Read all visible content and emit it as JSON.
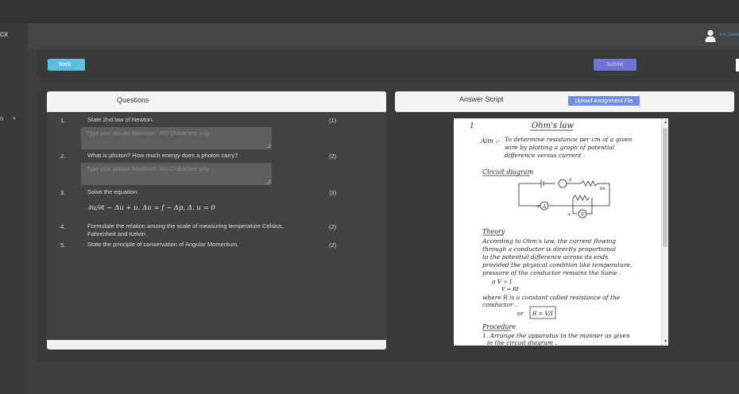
{
  "app": {
    "brand_fragment": "cx",
    "sidebar_fragment": "n",
    "user_name": "Eric Danielsen"
  },
  "toolbar": {
    "back_label": "Back",
    "submit_label": "Submit"
  },
  "questions_panel": {
    "title": "Questions",
    "answer_placeholder": "Type your answer Maximum  300 Characters only",
    "items": [
      {
        "num": "1.",
        "text": "State 2nd law of Newton.",
        "marks": "(1)"
      },
      {
        "num": "2.",
        "text": "What is photon? How much energy does a photon carry?",
        "marks": "(2)"
      },
      {
        "num": "3.",
        "text": "Solve the equation:",
        "marks": "(3)"
      },
      {
        "num": "4.",
        "text": "Formulate the relation among the scale of measuring temperature Celsius, Fahrenheit and Kelvin.",
        "marks": "(2)"
      },
      {
        "num": "5.",
        "text": "State the principle of conservation of Angular Momentum.",
        "marks": "(2)"
      }
    ],
    "equation": "∂u/∂t − Δu + u. Δu = f − Δp, Δ. u = 0"
  },
  "answer_panel": {
    "title": "Answer Script",
    "upload_label": "Upload Assignment File",
    "script": {
      "page_num": "1",
      "heading": "Ohm's law",
      "aim_label": "Aim :-",
      "aim_lines": [
        "To  determine resistance per cm of a given",
        "wire  by  plotting  a  graph of potential",
        "difference  versus current ."
      ],
      "circuit_label": "Circuit diagram",
      "theory_label": "Theory",
      "theory_lines": [
        "According  to  Ohm's law,  the  current flowing",
        "through  a  conductor  is  directly  proportional",
        "to  the  potential  difference  across  its  ends",
        "provided  the  physical  condition  like  temperature,",
        "pressure  of  the  conductor  remains  the  Same ."
      ],
      "prop_line": "a    V ∝ I",
      "eq_line": "V = RI",
      "where_lines": [
        "where  R  is  a  constant  called  resistance  of  the",
        "conductor ."
      ],
      "or_label": "or",
      "formula": "R = V/I",
      "procedure_label": "Procedure",
      "procedure_lines": [
        "1. Arrange  the  apparatus  in  the  manner  as  given",
        "in  the  circuit  diagram ."
      ]
    }
  },
  "colors": {
    "back_button": "#5bc0de",
    "submit_button": "#6f75d8",
    "upload_button": "#6f8ce6",
    "panel_header": "#f5f5f5",
    "answer_field": "#5e5e5e"
  },
  "icons": {
    "user": "user-icon",
    "sidebar_caret": "chevron-down-icon",
    "resize_grip": "resize-grip-icon"
  }
}
